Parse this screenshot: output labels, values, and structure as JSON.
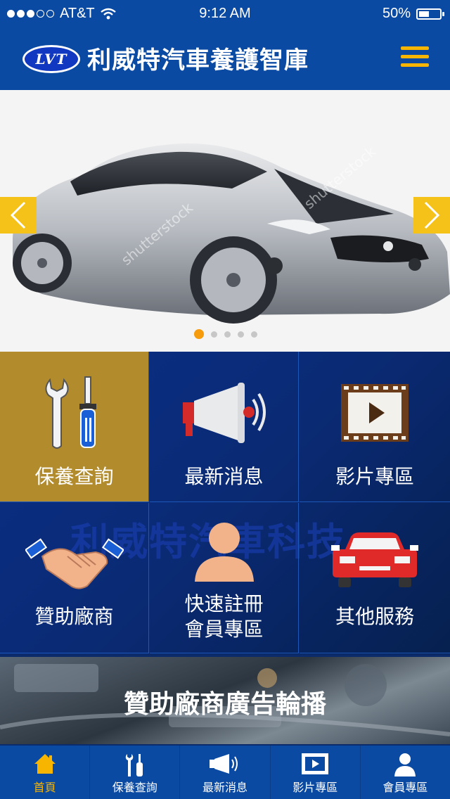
{
  "status_bar": {
    "carrier": "AT&T",
    "time": "9:12 AM",
    "battery": "50%",
    "battery_level": 0.5
  },
  "header": {
    "logo_text": "LVT",
    "title": "利威特汽車養護智庫"
  },
  "carousel": {
    "slide_count": 5,
    "active_index": 0,
    "watermark": "shutterstock"
  },
  "grid": {
    "watermark_text": "利威特汽車科技",
    "tiles": [
      {
        "label": "保養查詢",
        "icon": "wrench-screwdriver-icon"
      },
      {
        "label": "最新消息",
        "icon": "megaphone-icon"
      },
      {
        "label": "影片專區",
        "icon": "video-play-icon"
      },
      {
        "label": "贊助廠商",
        "icon": "handshake-icon"
      },
      {
        "label_line1": "快速註冊",
        "label_line2": "會員專區",
        "icon": "user-icon"
      },
      {
        "label": "其他服務",
        "icon": "car-icon"
      }
    ]
  },
  "banner": {
    "text": "贊助廠商廣告輪播"
  },
  "tabbar": [
    {
      "label": "首頁",
      "icon": "home-icon",
      "active": true
    },
    {
      "label": "保養查詢",
      "icon": "tools-icon",
      "active": false
    },
    {
      "label": "最新消息",
      "icon": "megaphone-icon",
      "active": false
    },
    {
      "label": "影片專區",
      "icon": "video-icon",
      "active": false
    },
    {
      "label": "會員專區",
      "icon": "user-icon",
      "active": false
    }
  ],
  "colors": {
    "primary": "#0b4aa2",
    "accent": "#f7b500",
    "gold_tile": "#c49624"
  }
}
